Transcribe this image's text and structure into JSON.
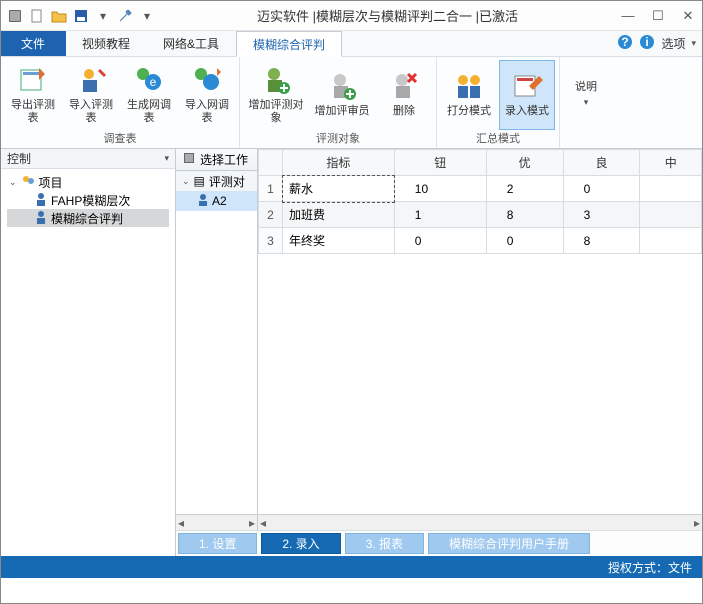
{
  "title": "迈实软件 |模糊层次与模糊评判二合一 |已激活",
  "qat": {
    "new_icon": "new-doc-icon",
    "open_icon": "folder-open-icon",
    "save_icon": "save-icon",
    "tools_icon": "tools-icon"
  },
  "tabs": {
    "file": "文件",
    "items": [
      "视频教程",
      "网络&工具",
      "模糊综合评判"
    ],
    "active_index": 2,
    "help_icon": "help-icon",
    "info_icon": "info-icon",
    "options_label": "选项"
  },
  "ribbon": {
    "groups": [
      {
        "label": "调查表",
        "items": [
          {
            "label": "导出评测表",
            "icon": "export-table-icon"
          },
          {
            "label": "导入评测表",
            "icon": "import-table-icon"
          },
          {
            "label": "生成网调表",
            "icon": "gen-web-icon"
          },
          {
            "label": "导入网调表",
            "icon": "import-web-icon"
          }
        ]
      },
      {
        "label": "评测对象",
        "items": [
          {
            "label": "增加评测对象",
            "icon": "add-target-icon"
          },
          {
            "label": "增加评审员",
            "icon": "add-reviewer-icon"
          },
          {
            "label": "删除",
            "icon": "delete-icon"
          }
        ]
      },
      {
        "label": "汇总模式",
        "items": [
          {
            "label": "打分模式",
            "icon": "score-mode-icon"
          },
          {
            "label": "录入模式",
            "icon": "input-mode-icon",
            "selected": true
          }
        ]
      },
      {
        "label": "",
        "items": [
          {
            "label": "说明",
            "icon": "help-text-icon",
            "dropdown": true
          }
        ]
      }
    ]
  },
  "left": {
    "title": "控制",
    "root": "项目",
    "children": [
      {
        "label": "FAHP模糊层次"
      },
      {
        "label": "模糊综合评判",
        "selected": true
      }
    ]
  },
  "mid": {
    "title": "选择工作",
    "header": "评测对",
    "item": "A2"
  },
  "grid": {
    "columns": [
      "指标",
      "钮",
      "优",
      "良",
      "中"
    ],
    "rows": [
      {
        "n": "1",
        "name": "薪水",
        "vals": [
          "10",
          "2",
          "0"
        ]
      },
      {
        "n": "2",
        "name": "加班费",
        "vals": [
          "1",
          "8",
          "3"
        ]
      },
      {
        "n": "3",
        "name": "年终奖",
        "vals": [
          "0",
          "0",
          "8"
        ]
      }
    ]
  },
  "bottom": {
    "b1": "1. 设置",
    "b2": "2. 录入",
    "b3": "3. 报表",
    "b4": "模糊综合评判用户手册"
  },
  "status": "授权方式：文件"
}
